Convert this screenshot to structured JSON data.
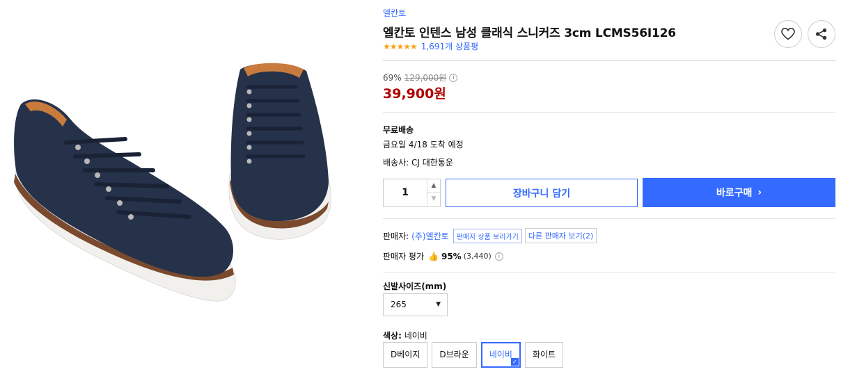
{
  "product": {
    "image_alt": "navy leather sneakers pair",
    "brand": "엘칸토",
    "title": "엘칸토 인텐스 남성 클래식 스니커즈 3cm LCMS56I126",
    "rating_stars": 4.5,
    "stars_text": "★★★★★",
    "review_count": "1,691개 상품평"
  },
  "actions": {
    "wish_icon": "heart-icon",
    "share_icon": "share-icon"
  },
  "price": {
    "discount": "69%",
    "original": "129,000원",
    "sale": "39,900원"
  },
  "shipping": {
    "title": "무료배송",
    "arrival": "금요일 4/18 도착 예정",
    "carrier": "배송사: CJ 대한통운"
  },
  "purchase": {
    "quantity": "1",
    "cart_label": "장바구니 담기",
    "buy_label": "바로구매"
  },
  "seller": {
    "label": "판매자:",
    "name": "(주)엘칸토",
    "products_label": "판매자 상품 보러가기",
    "other_sellers": "다른 판매자 보기(2)",
    "eval_label": "판매자 평가",
    "eval_pct": "95%",
    "eval_count": "(3,440)"
  },
  "options": {
    "size_label": "신발사이즈(mm)",
    "size_value": "265",
    "color_label": "색상:",
    "color_value": "네이비",
    "colors": [
      "D베이지",
      "D브라운",
      "네이비",
      "화이트"
    ],
    "selected_color_index": 2
  },
  "colors": {
    "accent": "#346aff",
    "sale_price": "#ae0000",
    "star": "#f7a31b"
  }
}
